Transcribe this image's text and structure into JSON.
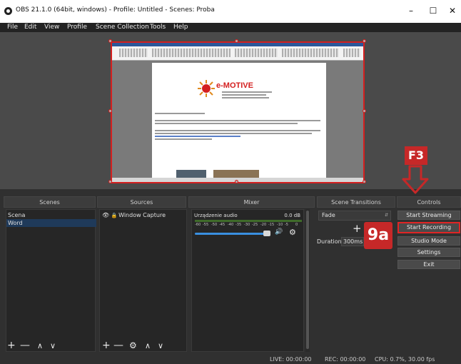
{
  "window": {
    "title": "OBS 21.1.0 (64bit, windows) - Profile: Untitled - Scenes: Proba"
  },
  "menu": [
    "File",
    "Edit",
    "View",
    "Profile",
    "Scene Collection",
    "Tools",
    "Help"
  ],
  "preview": {
    "doc_logo_text": "e-MOTIVE"
  },
  "panels": {
    "scenes": {
      "title": "Scenes",
      "items": [
        "Scena",
        "Word"
      ]
    },
    "sources": {
      "title": "Sources",
      "items": [
        "Window Capture"
      ]
    },
    "mixer": {
      "title": "Mixer",
      "channel": "Urządzenie audio",
      "level": "0.0 dB",
      "scale": [
        "-60",
        "-55",
        "-50",
        "-45",
        "-40",
        "-35",
        "-30",
        "-25",
        "-20",
        "-15",
        "-10",
        "-5",
        "0"
      ]
    },
    "transitions": {
      "title": "Scene Transitions",
      "selected": "Fade",
      "duration_label": "Duration",
      "duration_value": "300ms"
    },
    "controls": {
      "title": "Controls",
      "buttons": [
        "Start Streaming",
        "Start Recording",
        "Studio Mode",
        "Settings",
        "Exit"
      ]
    }
  },
  "status": {
    "live": "LIVE: 00:00:00",
    "rec": "REC: 00:00:00",
    "cpu": "CPU: 0.7%, 30.00 fps"
  },
  "annotations": {
    "f3": "F3",
    "step": "9a"
  },
  "colors": {
    "accent": "#d41f1f",
    "selection": "#1f3a5a",
    "volume": "#3a8fe0"
  }
}
